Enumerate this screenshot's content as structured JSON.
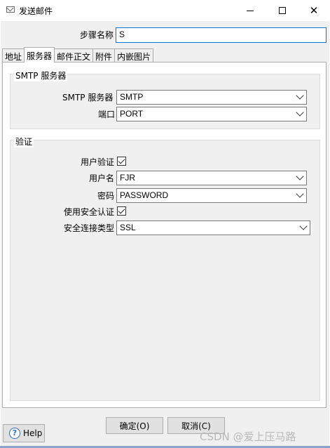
{
  "window": {
    "title": "发送邮件",
    "icon": "mail-icon",
    "minimize_glyph": "—",
    "maximize_glyph": "☐",
    "close_glyph": "✕"
  },
  "step_name": {
    "label": "步骤名称",
    "value": "S"
  },
  "tabs": [
    {
      "label": "地址",
      "active": false
    },
    {
      "label": "服务器",
      "active": true
    },
    {
      "label": "邮件正文",
      "active": false
    },
    {
      "label": "附件",
      "active": false
    },
    {
      "label": "内嵌图片",
      "active": false
    }
  ],
  "smtp_group": {
    "title": "SMTP 服务器",
    "server": {
      "label": "SMTP 服务器",
      "value": "SMTP"
    },
    "port": {
      "label": "端口",
      "value": "PORT"
    }
  },
  "auth_group": {
    "title": "验证",
    "user_auth": {
      "label": "用户验证",
      "checked": true
    },
    "username": {
      "label": "用户名",
      "value": "FJR"
    },
    "password": {
      "label": "密码",
      "value": "PASSWORD"
    },
    "secure_auth": {
      "label": "使用安全认证",
      "checked": true
    },
    "secure_type": {
      "label": "安全连接类型",
      "value": "SSL"
    }
  },
  "buttons": {
    "help": "Help",
    "help_icon": "?",
    "ok": "确定(O)",
    "cancel": "取消(C)"
  },
  "watermark": "CSDN @爱上压马路"
}
